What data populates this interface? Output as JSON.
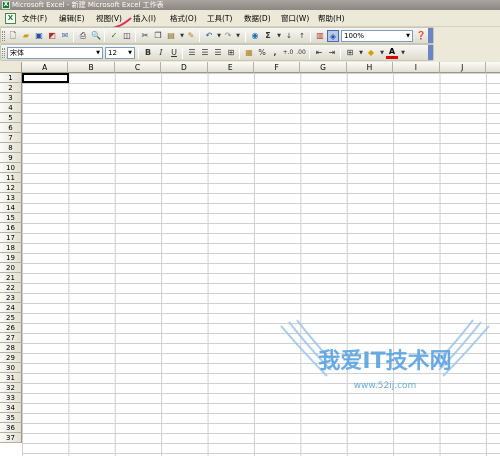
{
  "window": {
    "title": "Microsoft Excel - 新建 Microsoft Excel 工作表",
    "app_icon_glyph": "X"
  },
  "menubar": {
    "doc_icon_glyph": "X",
    "items": [
      {
        "label": "文件(F)"
      },
      {
        "label": "编辑(E)"
      },
      {
        "label": "视图(V)"
      },
      {
        "label": "插入(I)"
      },
      {
        "label": "格式(O)"
      },
      {
        "label": "工具(T)"
      },
      {
        "label": "数据(D)"
      },
      {
        "label": "窗口(W)"
      },
      {
        "label": "帮助(H)"
      }
    ]
  },
  "toolbar_standard": {
    "sum_glyph": "Σ",
    "zoom": "100%"
  },
  "toolbar_format": {
    "font": "宋体",
    "size": "12",
    "bold": "B",
    "italic": "I",
    "underline": "U",
    "percent": "%",
    "comma": ",",
    "font_color_glyph": "A"
  },
  "sheet": {
    "columns": [
      "A",
      "B",
      "C",
      "D",
      "E",
      "F",
      "G",
      "H",
      "I",
      "J"
    ],
    "rows": [
      "1",
      "2",
      "3",
      "4",
      "5",
      "6",
      "7",
      "8",
      "9",
      "10",
      "11",
      "12",
      "13",
      "14",
      "15",
      "16",
      "17",
      "18",
      "19",
      "20",
      "21",
      "22",
      "23",
      "24",
      "25",
      "26",
      "27",
      "28",
      "29",
      "30",
      "31",
      "32",
      "33",
      "34",
      "35",
      "36",
      "37"
    ]
  },
  "watermark": {
    "text": "我爱IT技术网",
    "url": "www.52ij.com"
  }
}
